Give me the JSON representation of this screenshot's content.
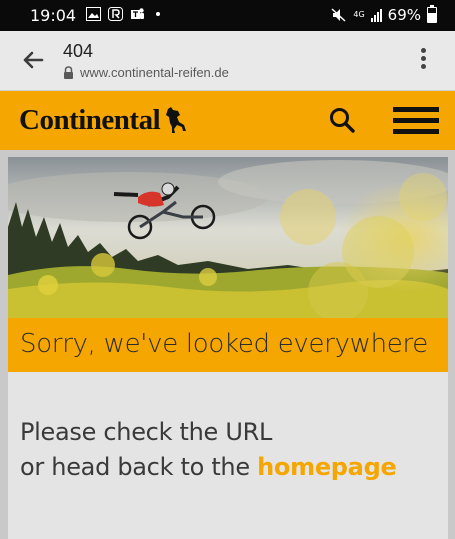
{
  "status_bar": {
    "time": "19:04",
    "network": "4G",
    "battery": "69%"
  },
  "browser": {
    "page_title": "404",
    "url": "www.continental-reifen.de"
  },
  "site": {
    "logo_text": "Continental",
    "brand_color": "#f5a600"
  },
  "error_page": {
    "banner_text": "Sorry, we've looked everywhere",
    "message_line1": "Please check the URL",
    "message_line2_prefix": "or head back to the ",
    "homepage_link": "homepage"
  },
  "icons": [
    "back-arrow-icon",
    "lock-icon",
    "more-vert-icon",
    "search-icon",
    "hamburger-menu-icon",
    "horse-icon"
  ]
}
